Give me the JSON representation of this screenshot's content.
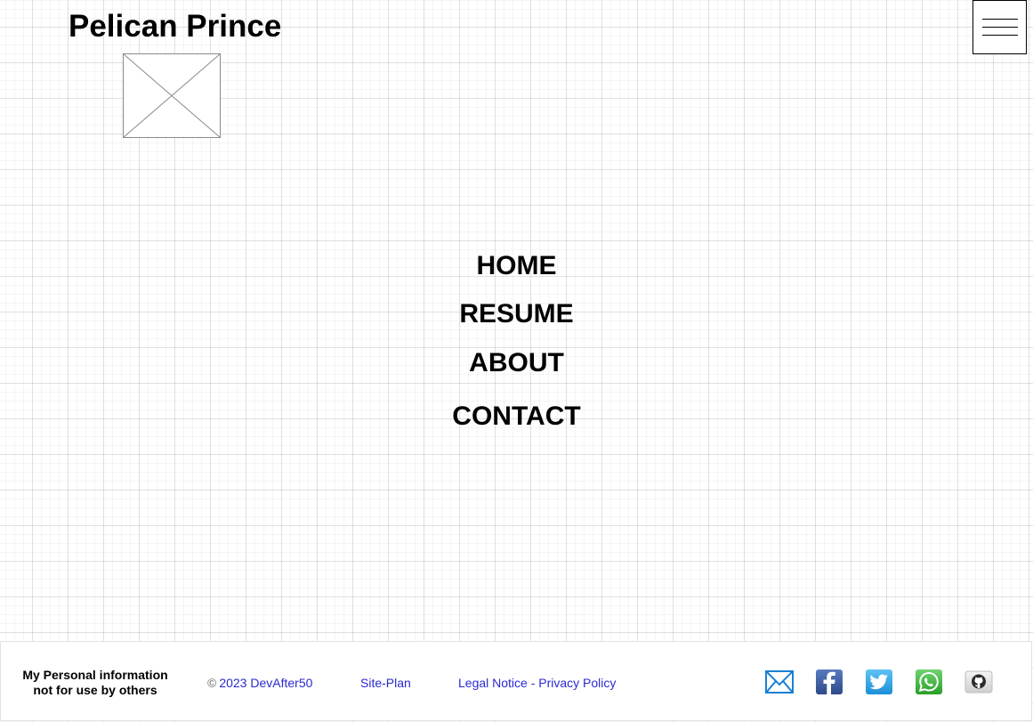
{
  "header": {
    "site_title": "Pelican Prince",
    "logo": "image-placeholder",
    "menu_icon": "hamburger-icon"
  },
  "nav": {
    "items": [
      {
        "label": "HOME"
      },
      {
        "label": "RESUME"
      },
      {
        "label": "ABOUT"
      },
      {
        "label": "CONTACT"
      }
    ]
  },
  "footer": {
    "disclaimer_line1": "My Personal information",
    "disclaimer_line2": "not for use by others",
    "copyright_symbol": "©",
    "copyright_text": "2023 DevAfter50",
    "site_plan": "Site-Plan",
    "legal": "Legal Notice - Privacy Policy",
    "social": [
      {
        "icon": "mail-icon",
        "color": "#1a7fd4"
      },
      {
        "icon": "facebook-icon",
        "color": "#3b5998"
      },
      {
        "icon": "twitter-icon",
        "color": "#1da1f2"
      },
      {
        "icon": "whatsapp-icon",
        "color": "#3cb43c"
      },
      {
        "icon": "github-icon",
        "color": "#333333"
      }
    ]
  },
  "colors": {
    "link": "#2a2ad0",
    "text": "#000000"
  }
}
